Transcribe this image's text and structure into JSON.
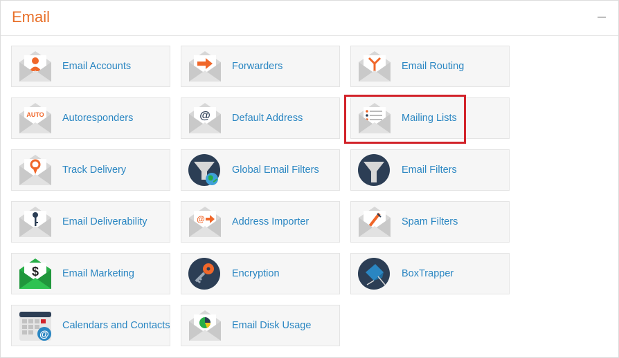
{
  "section": {
    "title": "Email",
    "collapse_icon": "minus-icon"
  },
  "items": [
    {
      "label": "Email Accounts",
      "icon": "email-account-icon"
    },
    {
      "label": "Forwarders",
      "icon": "forwarders-icon"
    },
    {
      "label": "Email Routing",
      "icon": "email-routing-icon"
    },
    {
      "label": "Autoresponders",
      "icon": "autoresponders-icon",
      "icon_text": "AUTO"
    },
    {
      "label": "Default Address",
      "icon": "default-address-icon",
      "icon_text": "@"
    },
    {
      "label": "Mailing Lists",
      "icon": "mailing-lists-icon"
    },
    {
      "label": "Track Delivery",
      "icon": "track-delivery-icon"
    },
    {
      "label": "Global Email Filters",
      "icon": "global-email-filters-icon"
    },
    {
      "label": "Email Filters",
      "icon": "email-filters-icon"
    },
    {
      "label": "Email Deliverability",
      "icon": "email-deliverability-icon"
    },
    {
      "label": "Address Importer",
      "icon": "address-importer-icon",
      "icon_text": "@"
    },
    {
      "label": "Spam Filters",
      "icon": "spam-filters-icon"
    },
    {
      "label": "Email Marketing",
      "icon": "email-marketing-icon",
      "icon_text": "$"
    },
    {
      "label": "Encryption",
      "icon": "encryption-icon"
    },
    {
      "label": "BoxTrapper",
      "icon": "boxtrapper-icon"
    },
    {
      "label": "Calendars and Contacts",
      "icon": "calendars-contacts-icon",
      "icon_text": "@"
    },
    {
      "label": "Email Disk Usage",
      "icon": "email-disk-usage-icon"
    }
  ],
  "colors": {
    "title": "#e8702a",
    "link": "#2a86c2",
    "accent_orange": "#f0672a",
    "highlight": "#d2232a",
    "envelope": "#d7d7d7",
    "dark_circle": "#2c3e55",
    "green": "#27ae47"
  },
  "highlighted_item": "Mailing Lists"
}
